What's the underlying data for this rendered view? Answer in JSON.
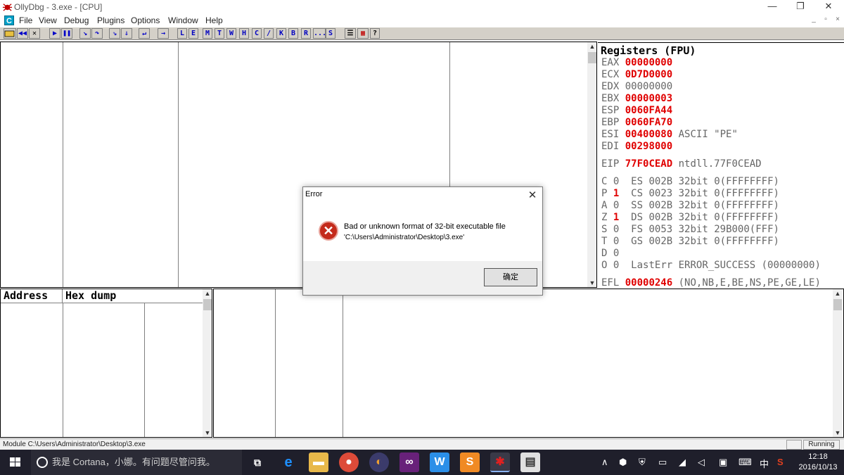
{
  "window": {
    "title": "OllyDbg - 3.exe - [CPU]",
    "controls": [
      "—",
      "❐",
      "✕"
    ]
  },
  "menu": {
    "items": [
      "File",
      "View",
      "Debug",
      "Plugins",
      "Options",
      "Window",
      "Help"
    ],
    "mdi_icon": "C",
    "mdi_controls": [
      "_",
      "▫",
      "×"
    ]
  },
  "toolbar": {
    "letters": [
      "L",
      "E",
      "M",
      "T",
      "W",
      "H",
      "C",
      "/",
      "K",
      "B",
      "R",
      "...",
      "S"
    ],
    "help": "?"
  },
  "registers": {
    "title": "Registers (FPU)",
    "general": [
      {
        "name": "EAX",
        "value": "00000000",
        "changed": true,
        "comment": ""
      },
      {
        "name": "ECX",
        "value": "0D7D0000",
        "changed": true,
        "comment": ""
      },
      {
        "name": "EDX",
        "value": "00000000",
        "changed": false,
        "comment": ""
      },
      {
        "name": "EBX",
        "value": "00000003",
        "changed": true,
        "comment": ""
      },
      {
        "name": "ESP",
        "value": "0060FA44",
        "changed": true,
        "comment": ""
      },
      {
        "name": "EBP",
        "value": "0060FA70",
        "changed": true,
        "comment": ""
      },
      {
        "name": "ESI",
        "value": "00400080",
        "changed": true,
        "comment": "ASCII \"PE\""
      },
      {
        "name": "EDI",
        "value": "00298000",
        "changed": true,
        "comment": ""
      }
    ],
    "eip": {
      "name": "EIP",
      "value": "77F0CEAD",
      "comment": "ntdll.77F0CEAD"
    },
    "flags": [
      {
        "flag": "C",
        "val": "0",
        "changed": false,
        "seg": "ES",
        "sel": "002B",
        "bits": "32bit",
        "base": "0(FFFFFFFF)"
      },
      {
        "flag": "P",
        "val": "1",
        "changed": true,
        "seg": "CS",
        "sel": "0023",
        "bits": "32bit",
        "base": "0(FFFFFFFF)"
      },
      {
        "flag": "A",
        "val": "0",
        "changed": false,
        "seg": "SS",
        "sel": "002B",
        "bits": "32bit",
        "base": "0(FFFFFFFF)"
      },
      {
        "flag": "Z",
        "val": "1",
        "changed": true,
        "seg": "DS",
        "sel": "002B",
        "bits": "32bit",
        "base": "0(FFFFFFFF)"
      },
      {
        "flag": "S",
        "val": "0",
        "changed": false,
        "seg": "FS",
        "sel": "0053",
        "bits": "32bit",
        "base": "29B000(FFF)"
      },
      {
        "flag": "T",
        "val": "0",
        "changed": false,
        "seg": "GS",
        "sel": "002B",
        "bits": "32bit",
        "base": "0(FFFFFFFF)"
      },
      {
        "flag": "D",
        "val": "0",
        "changed": false,
        "seg": "",
        "sel": "",
        "bits": "",
        "base": ""
      },
      {
        "flag": "O",
        "val": "0",
        "changed": false,
        "seg": "LastErr",
        "sel": "",
        "bits": "",
        "base": "ERROR_SUCCESS (00000000)"
      }
    ],
    "efl": {
      "name": "EFL",
      "value": "00000246",
      "comment": "(NO,NB,E,BE,NS,PE,GE,LE)"
    }
  },
  "dump": {
    "address_header": "Address",
    "hex_header": "Hex dump"
  },
  "dialog": {
    "title": "Error",
    "close": "✕",
    "line1": "Bad or unknown format of 32-bit executable file",
    "line2": "'C:\\Users\\Administrator\\Desktop\\3.exe'",
    "ok_label": "确定",
    "icon": "error-icon"
  },
  "status": {
    "message": "Module C:\\Users\\Administrator\\Desktop\\3.exe",
    "state": "Running"
  },
  "taskbar": {
    "search_placeholder": "我是 Cortana，小娜。有问题尽管问我。",
    "tray_ime": "中",
    "time": "12:18",
    "date": "2016/10/13"
  }
}
